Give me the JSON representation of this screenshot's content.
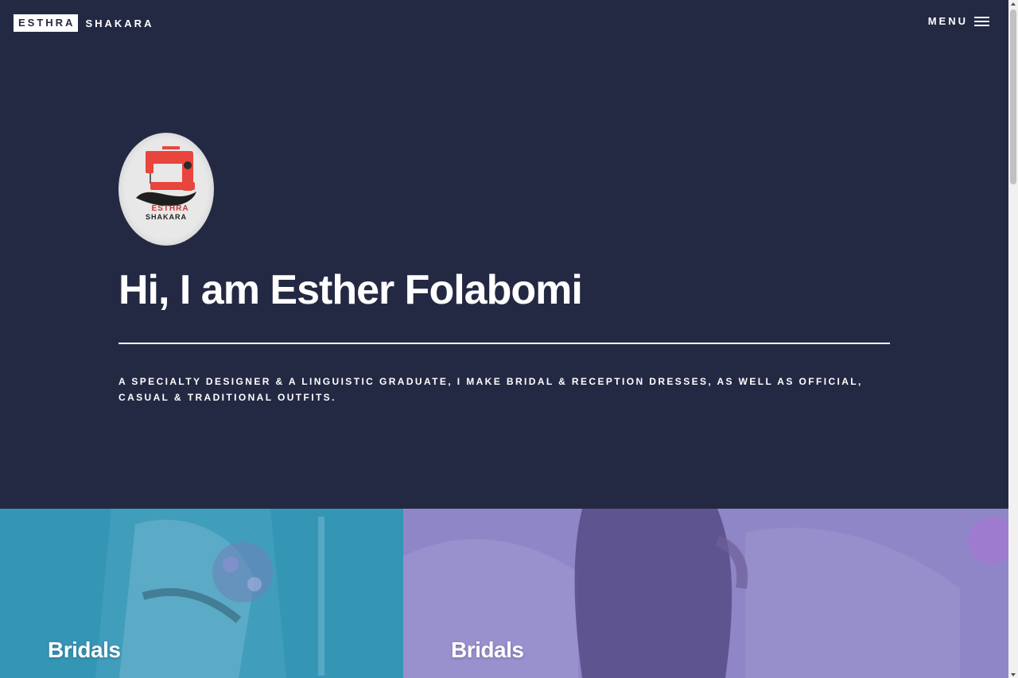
{
  "header": {
    "logo_box": "ESTHRA",
    "logo_rest": "SHAKARA",
    "menu_label": "MENU"
  },
  "hero": {
    "avatar_alt": "Esthra Shakara logo",
    "avatar_text_top": "ESTHRA",
    "avatar_text_bottom": "SHAKARA",
    "title": "Hi, I am Esther Folabomi",
    "subtitle": "A specialty designer & a linguistic graduate, I make bridal & reception dresses, as well as official, casual & traditional outfits."
  },
  "tiles": [
    {
      "title": "Bridals",
      "color": "#3595b5"
    },
    {
      "title": "Bridals",
      "color": "#8f86c8"
    }
  ],
  "colors": {
    "background": "#242943",
    "text": "#ffffff",
    "machine_red": "#e8453c"
  },
  "icons": {
    "menu": "hamburger-icon",
    "avatar": "sewing-machine-icon"
  }
}
